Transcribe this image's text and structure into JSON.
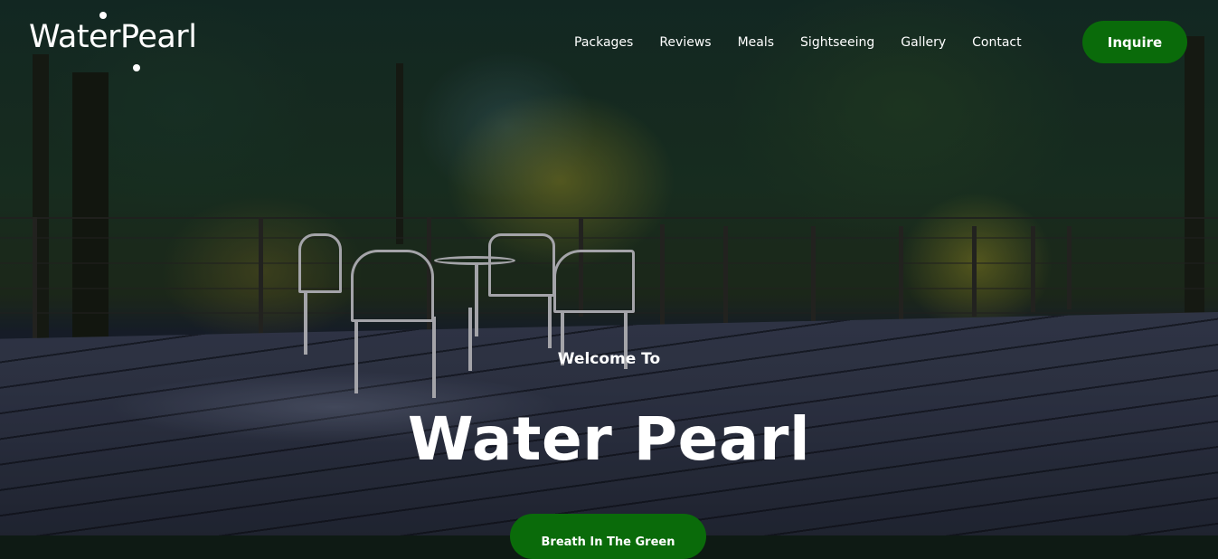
{
  "brand": {
    "name": "WaterPearl"
  },
  "nav": {
    "items": [
      {
        "label": "Packages"
      },
      {
        "label": "Reviews"
      },
      {
        "label": "Meals"
      },
      {
        "label": "Sightseeing"
      },
      {
        "label": "Gallery"
      },
      {
        "label": "Contact"
      }
    ],
    "cta_label": "Inquire"
  },
  "hero": {
    "eyebrow": "Welcome To",
    "title": "Water Pearl",
    "button_label": "Breath In The Green"
  },
  "colors": {
    "accent": "#0a6b0a",
    "text": "#ffffff"
  }
}
